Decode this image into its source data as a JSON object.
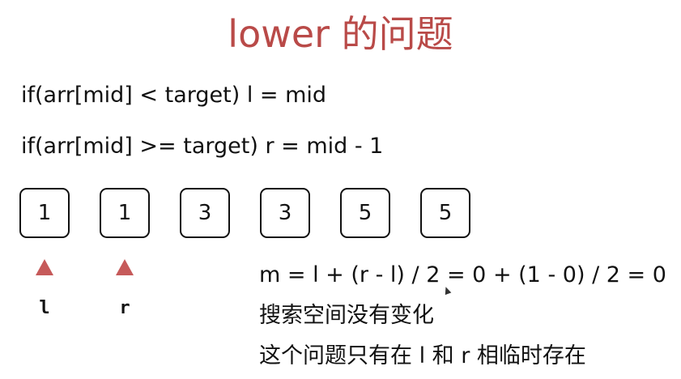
{
  "title": "lower 的问题",
  "code": {
    "line1": "if(arr[mid] < target) l = mid",
    "line2": "if(arr[mid] >= target) r = mid - 1"
  },
  "array": {
    "values": [
      "1",
      "1",
      "3",
      "3",
      "5",
      "5"
    ]
  },
  "pointers": {
    "left": "l",
    "right": "r"
  },
  "notes": {
    "formula": "m = l + (r - l) / 2 = 0 + (1 - 0) / 2 = 0",
    "line2": "搜索空间没有变化",
    "line3": "这个问题只有在 l 和 r 相临时存在"
  },
  "colors": {
    "title": "#b94a48",
    "pointer": "#c65a5a"
  }
}
